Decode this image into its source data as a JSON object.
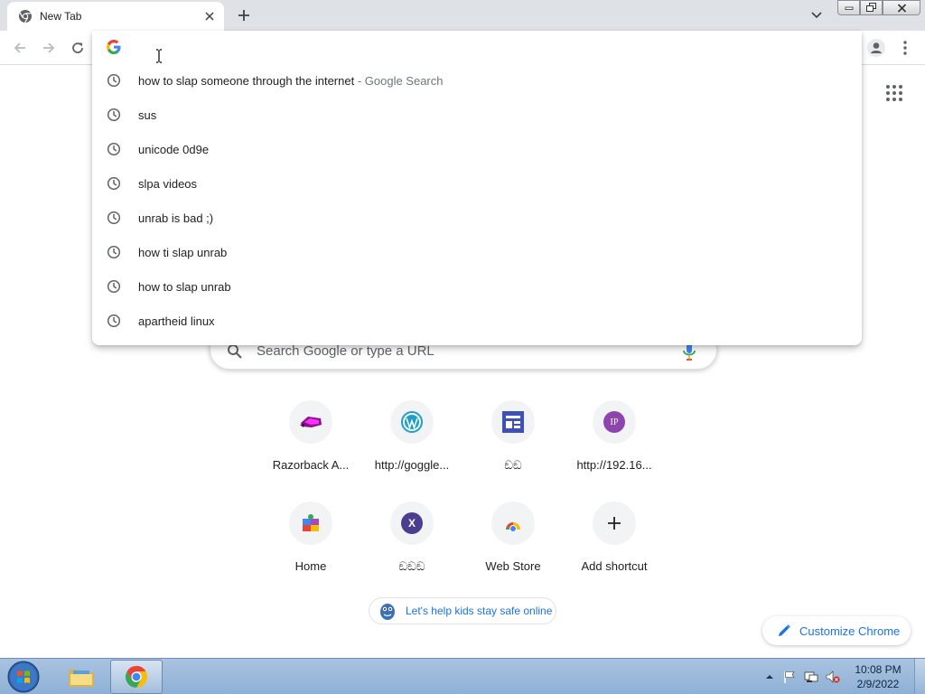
{
  "colors": {
    "tabstrip_bg": "#dee1e6",
    "link_blue": "#1a73e8",
    "suggestion_suffix": "#70757a",
    "taskbar": "#9db9dc"
  },
  "tab": {
    "title": "New Tab",
    "favicon": "chrome-icon",
    "close_icon": "close-icon"
  },
  "toolbar": {
    "back_icon": "back-arrow-icon",
    "forward_icon": "forward-arrow-icon",
    "reload_icon": "reload-icon",
    "profile_icon": "profile-icon",
    "menu_icon": "kebab-menu-icon"
  },
  "omnibox": {
    "value": "",
    "suggestions": [
      {
        "text": "how to slap someone through the internet",
        "suffix": " - Google Search"
      },
      {
        "text": "sus",
        "suffix": ""
      },
      {
        "text": "unicode 0d9e",
        "suffix": ""
      },
      {
        "text": "slpa videos",
        "suffix": ""
      },
      {
        "text": "unrab is bad ;)",
        "suffix": ""
      },
      {
        "text": "how ti slap unrab",
        "suffix": ""
      },
      {
        "text": "how to slap unrab",
        "suffix": ""
      },
      {
        "text": "apartheid linux",
        "suffix": ""
      }
    ]
  },
  "ntp": {
    "search_placeholder": "Search Google or type a URL",
    "shortcuts": [
      {
        "label": "Razorback A...",
        "icon": "razorback-icon"
      },
      {
        "label": "http://goggle...",
        "icon": "wordpress-icon"
      },
      {
        "label": "ඞඞ",
        "icon": "layout-icon"
      },
      {
        "label": "http://192.16...",
        "icon": "ip-icon",
        "icon_text": "IP"
      },
      {
        "label": "Home",
        "icon": "puzzle-icon"
      },
      {
        "label": "ඞඞඞ",
        "icon": "letter-x-icon",
        "icon_text": "X"
      },
      {
        "label": "Web Store",
        "icon": "web-store-icon"
      },
      {
        "label": "Add shortcut",
        "icon": "plus-icon",
        "icon_text": "+"
      }
    ],
    "promo_text": "Let's help kids stay safe online",
    "customize_label": "Customize Chrome"
  },
  "taskbar": {
    "time": "10:08 PM",
    "date": "2/9/2022",
    "tray_icons": [
      "show-hidden-icons-icon",
      "action-center-flag-icon",
      "network-icon",
      "volume-muted-icon"
    ]
  }
}
